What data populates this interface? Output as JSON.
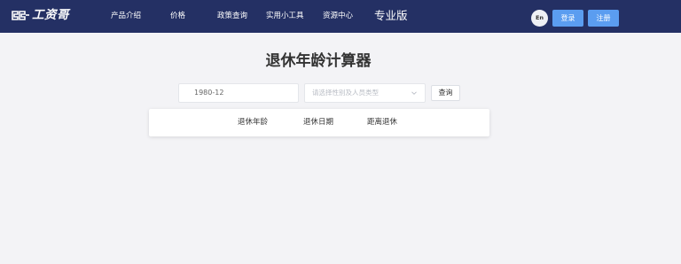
{
  "header": {
    "brand": "工资哥",
    "nav": [
      {
        "label": "产品介绍"
      },
      {
        "label": "价格"
      },
      {
        "label": "政策查询"
      },
      {
        "label": "实用小工具"
      },
      {
        "label": "资源中心"
      }
    ],
    "edition": "专业版",
    "lang": "En",
    "login": "登录",
    "register": "注册",
    "bg_color": "#243064",
    "button_color": "#5b9df0"
  },
  "main": {
    "title": "退休年龄计算器",
    "birth_input": {
      "value": "1980-12"
    },
    "type_select": {
      "placeholder": "请选择性别及人员类型",
      "icon": "chevron-down-icon"
    },
    "query_button": "查询",
    "result_columns": [
      "退休年龄",
      "退休日期",
      "距离退休"
    ]
  }
}
